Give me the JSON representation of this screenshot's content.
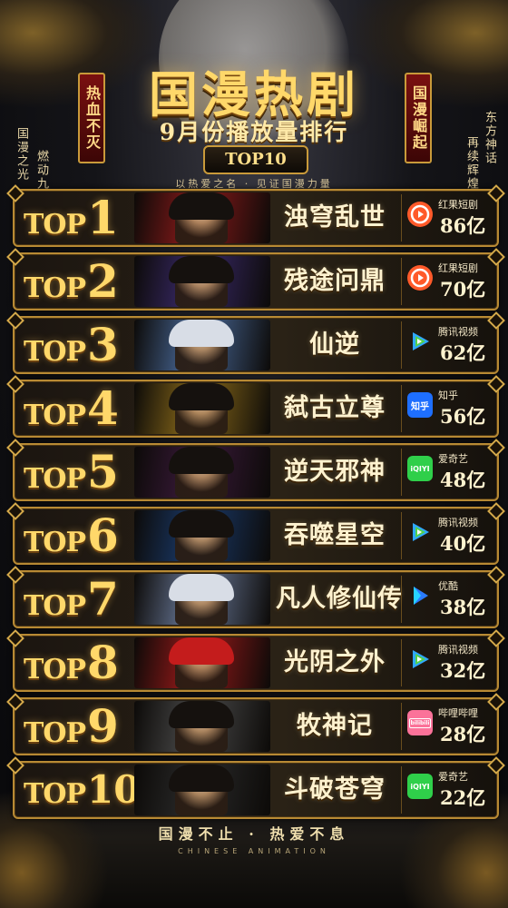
{
  "header": {
    "title": "国漫热剧",
    "subtitle": "9月份播放量排行",
    "badge": "TOP10",
    "slogan": "以热爱之名 · 见证国漫力量",
    "banner_left": "热血不灭",
    "banner_right": "国漫崛起",
    "side_left_1": "国漫之光",
    "side_left_2": "燃动九",
    "side_right_1": "东方神话",
    "side_right_2": "再续辉煌"
  },
  "ranking": [
    {
      "top": "TOP",
      "num": "1",
      "title": "浊穹乱世",
      "platform": "红果短剧",
      "icon": "hongguo-icon",
      "count": "86亿",
      "color": "#ff5a2a"
    },
    {
      "top": "TOP",
      "num": "2",
      "title": "残途问鼎",
      "platform": "红果短剧",
      "icon": "hongguo-icon",
      "count": "70亿",
      "color": "#ff5a2a"
    },
    {
      "top": "TOP",
      "num": "3",
      "title": "仙逆",
      "platform": "腾讯视频",
      "icon": "tencent-video-icon",
      "count": "62亿",
      "color": "#2fa8ff"
    },
    {
      "top": "TOP",
      "num": "4",
      "title": "弑古立尊",
      "platform": "知乎",
      "icon": "zhihu-icon",
      "count": "56亿",
      "color": "#1e6fff"
    },
    {
      "top": "TOP",
      "num": "5",
      "title": "逆天邪神",
      "platform": "爱奇艺",
      "icon": "iqiyi-icon",
      "count": "48亿",
      "color": "#2fcf4a"
    },
    {
      "top": "TOP",
      "num": "6",
      "title": "吞噬星空",
      "platform": "腾讯视频",
      "icon": "tencent-video-icon",
      "count": "40亿",
      "color": "#2fa8ff"
    },
    {
      "top": "TOP",
      "num": "7",
      "title": "凡人修仙传",
      "platform": "优酷",
      "icon": "youku-icon",
      "count": "38亿",
      "color": "#2a7bff"
    },
    {
      "top": "TOP",
      "num": "8",
      "title": "光阴之外",
      "platform": "腾讯视频",
      "icon": "tencent-video-icon",
      "count": "32亿",
      "color": "#2fa8ff"
    },
    {
      "top": "TOP",
      "num": "9",
      "title": "牧神记",
      "platform": "哔哩哔哩",
      "icon": "bilibili-icon",
      "count": "28亿",
      "color": "#fb7299"
    },
    {
      "top": "TOP",
      "num": "10",
      "title": "斗破苍穹",
      "platform": "爱奇艺",
      "icon": "iqiyi-icon",
      "count": "22亿",
      "color": "#2fcf4a"
    }
  ],
  "icon_text": {
    "zhihu": "知乎",
    "iqiyi": "iQIYI",
    "bilibili": "bilibili"
  },
  "poster_colors": [
    "#8a1a1a",
    "#3a2a6a",
    "#4a6a9a",
    "#8a6a1a",
    "#3a1a3a",
    "#1a3a6a",
    "#6a7a9a",
    "#9a1a1a",
    "#4a4a4a",
    "#2a2a2a"
  ],
  "footer": {
    "main": "国漫不止 · 热爱不息",
    "sub": "CHINESE ANIMATION"
  }
}
